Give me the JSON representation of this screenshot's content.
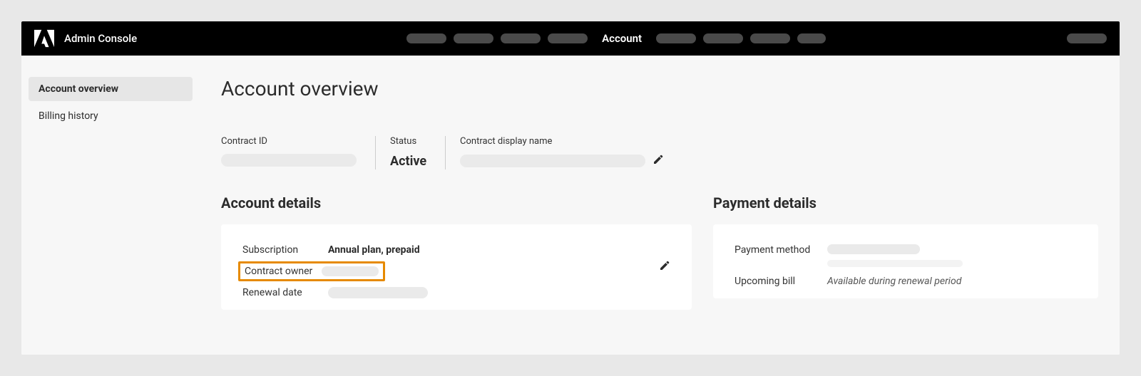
{
  "header": {
    "title": "Admin Console",
    "activeNav": "Account"
  },
  "sidebar": {
    "items": [
      {
        "label": "Account overview",
        "active": true
      },
      {
        "label": "Billing history",
        "active": false
      }
    ]
  },
  "page": {
    "title": "Account overview"
  },
  "meta": {
    "contractIdLabel": "Contract ID",
    "statusLabel": "Status",
    "statusValue": "Active",
    "displayNameLabel": "Contract display name"
  },
  "accountDetails": {
    "heading": "Account details",
    "subscriptionLabel": "Subscription",
    "subscriptionValue": "Annual plan, prepaid",
    "contractOwnerLabel": "Contract owner",
    "renewalDateLabel": "Renewal date"
  },
  "paymentDetails": {
    "heading": "Payment details",
    "paymentMethodLabel": "Payment method",
    "upcomingBillLabel": "Upcoming bill",
    "upcomingBillValue": "Available during renewal period"
  }
}
